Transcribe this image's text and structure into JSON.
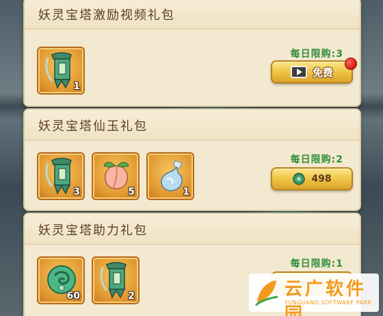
{
  "packs": [
    {
      "title": "妖灵宝塔激励视频礼包",
      "limit": "每日限购:3",
      "button": {
        "type": "video",
        "label": "免费"
      },
      "has_red_dot": true,
      "items": [
        {
          "icon": "jade-token-banner-icon",
          "count": "1"
        }
      ]
    },
    {
      "title": "妖灵宝塔仙玉礼包",
      "limit": "每日限购:2",
      "button": {
        "type": "price",
        "label": "498"
      },
      "has_red_dot": false,
      "items": [
        {
          "icon": "jade-token-banner-icon",
          "count": "3"
        },
        {
          "icon": "peach-icon",
          "count": "5"
        },
        {
          "icon": "spirit-water-icon",
          "count": "1"
        }
      ]
    },
    {
      "title": "妖灵宝塔助力礼包",
      "limit": "每日限购:1",
      "button": {
        "type": "price",
        "label": ""
      },
      "has_red_dot": false,
      "items": [
        {
          "icon": "jade-dragon-icon",
          "count": "60"
        },
        {
          "icon": "jade-token-banner-icon",
          "count": "2"
        }
      ]
    }
  ],
  "watermark": {
    "cn": "云广软件园",
    "en": "YUNGUANG SOFTWARE PARK"
  },
  "colors": {
    "panel": "#f3e9d0",
    "limit_green": "#2f8d3a",
    "button_gold": "#efc544",
    "title_brown": "#5a3e28"
  }
}
